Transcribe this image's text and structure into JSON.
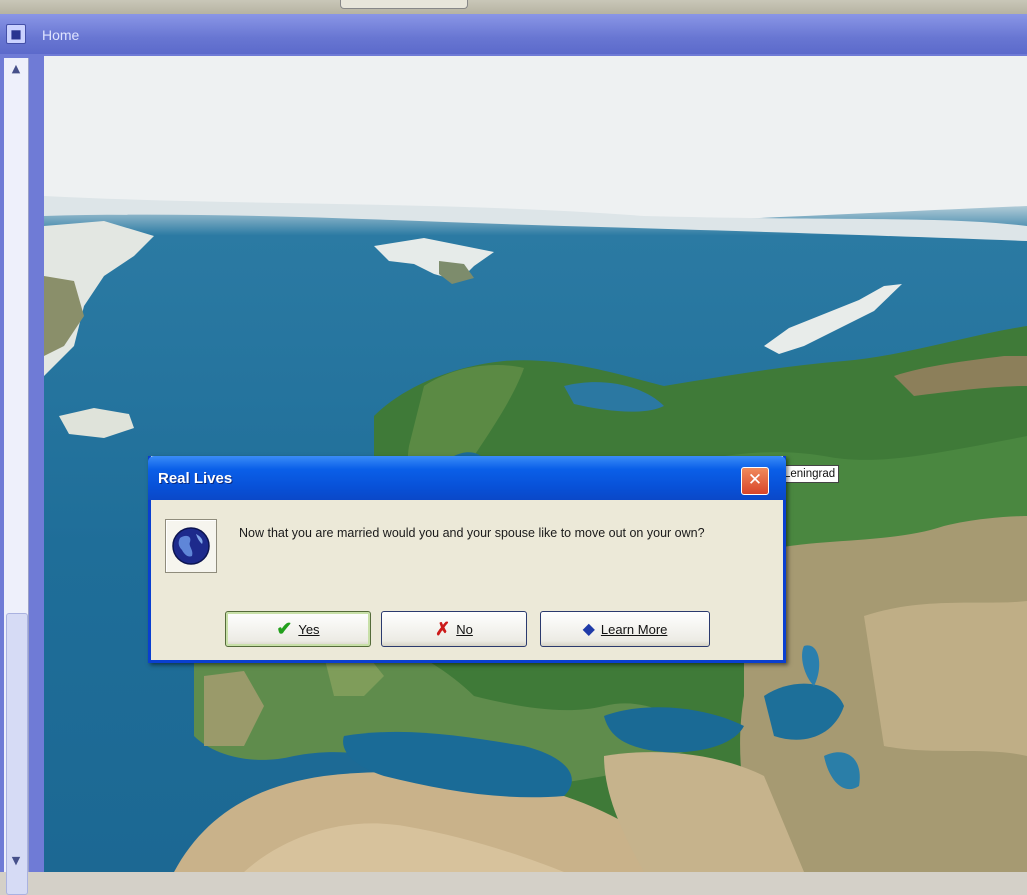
{
  "window": {
    "title": "Home"
  },
  "map": {
    "location_label": "Leningrad"
  },
  "dialog": {
    "title": "Real Lives",
    "message": "Now that you are married would you and your spouse like to move out on your own?",
    "buttons": {
      "yes": "Yes",
      "no": "No",
      "learn_more": "Learn More"
    }
  },
  "icons": [
    "window-system-icon",
    "scroll-up-icon",
    "scroll-down-icon",
    "close-icon",
    "globe-icon",
    "check-icon",
    "x-icon",
    "learn-more-icon"
  ],
  "colors": {
    "dialog_title": "#0a5fe8",
    "window_title": "#6876d2",
    "ocean": "#1f6e99"
  }
}
